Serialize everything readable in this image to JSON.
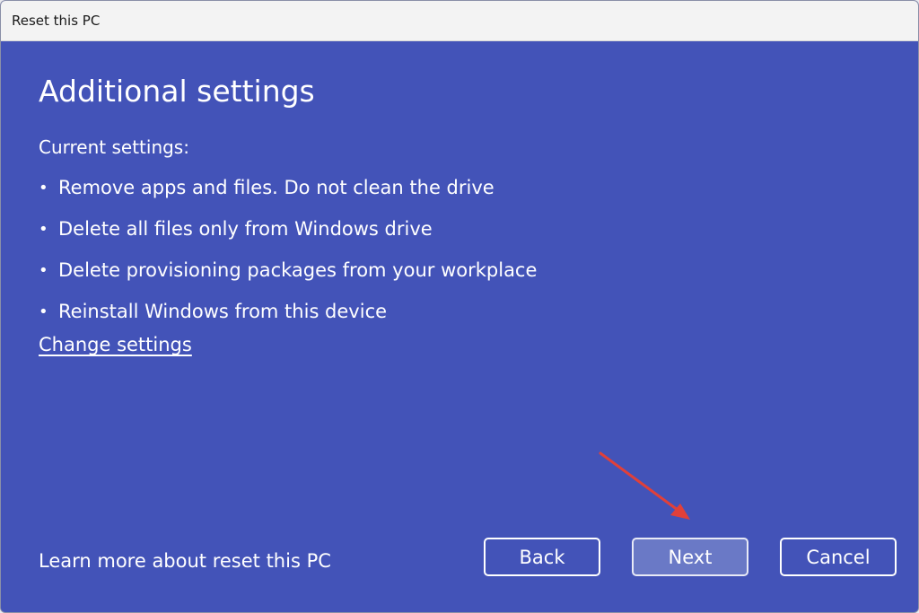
{
  "window": {
    "title": "Reset this PC"
  },
  "main": {
    "heading": "Additional settings",
    "current_label": "Current settings:",
    "bullets": [
      "Remove apps and files. Do not clean the drive",
      "Delete all files only from Windows drive",
      "Delete provisioning packages from your workplace",
      "Reinstall Windows from this device"
    ],
    "bullet_char": "•",
    "change_link": "Change settings"
  },
  "footer": {
    "learn_more": "Learn more about reset this PC",
    "back_label": "Back",
    "next_label": "Next",
    "cancel_label": "Cancel"
  },
  "colors": {
    "background": "#4353b8",
    "next_button": "#6a79c6",
    "annotation_arrow": "#e0403a"
  }
}
